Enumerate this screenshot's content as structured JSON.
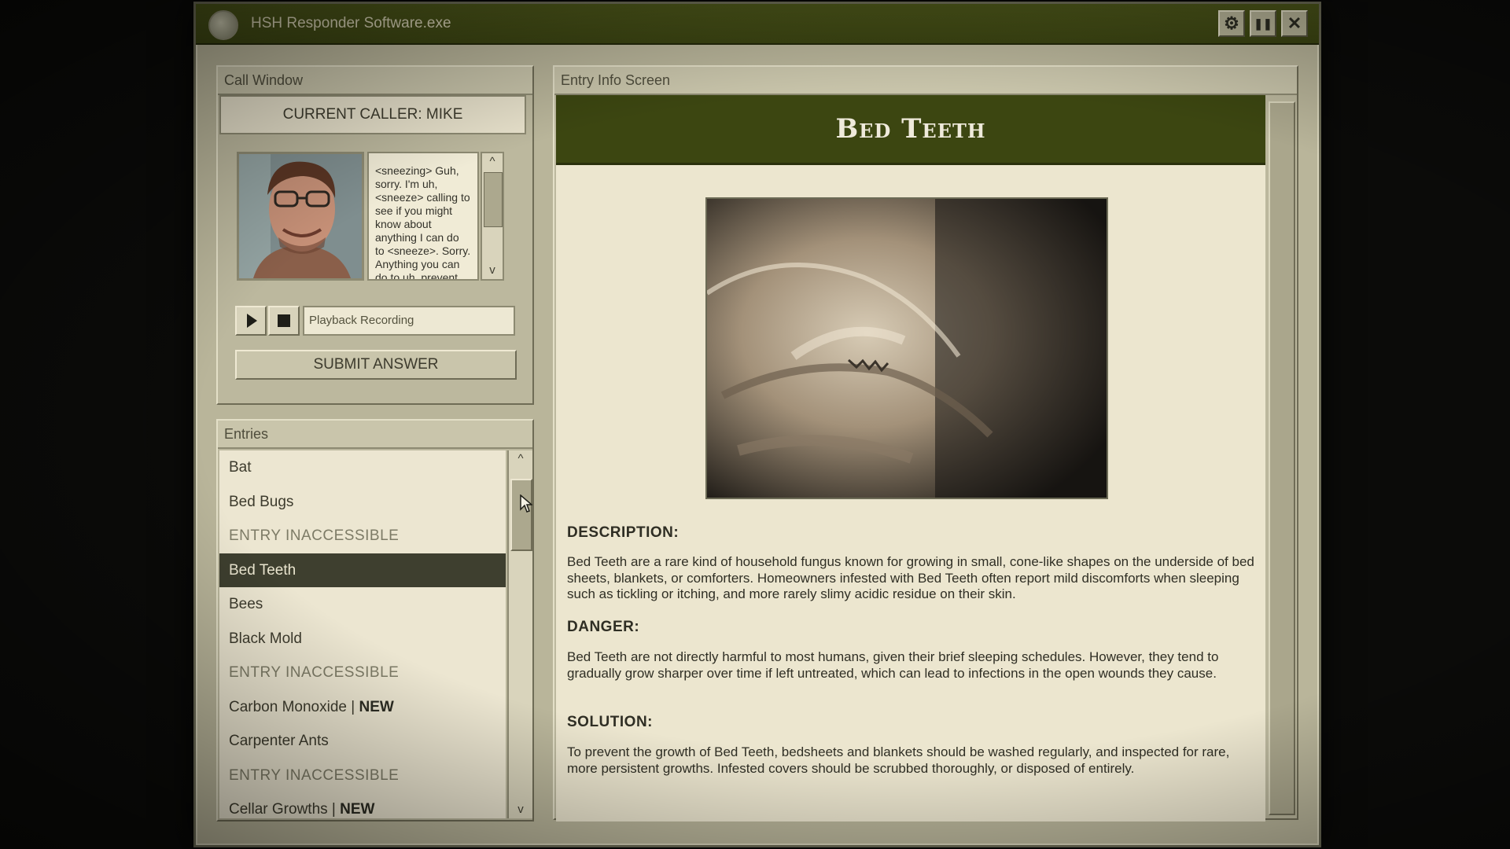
{
  "window": {
    "title": "HSH Responder Software.exe",
    "controls": {
      "settings": "⚙",
      "pause": "❚❚",
      "close": "✕"
    }
  },
  "call_window": {
    "panel_title": "Call Window",
    "current_caller": "CURRENT CALLER: MIKE",
    "transcript": "<sneezing> Guh, sorry. I'm uh, <sneeze> calling to see if you might know about anything I can do to <sneeze>. Sorry. Anything you can do to uh, prevent",
    "scroll_up": "^",
    "scroll_down": "v",
    "playback_placeholder": "Playback Recording",
    "submit_label": "SUBMIT ANSWER"
  },
  "entries_panel": {
    "panel_title": "Entries",
    "scroll_up": "^",
    "scroll_down": "v",
    "items": [
      {
        "label": "Bat",
        "badge": ""
      },
      {
        "label": "Bed Bugs",
        "badge": ""
      },
      {
        "label": "ENTRY INACCESSIBLE",
        "badge": ""
      },
      {
        "label": "Bed Teeth",
        "badge": ""
      },
      {
        "label": "Bees",
        "badge": ""
      },
      {
        "label": "Black Mold",
        "badge": ""
      },
      {
        "label": "ENTRY INACCESSIBLE",
        "badge": ""
      },
      {
        "label": "Carbon Monoxide | ",
        "badge": "NEW"
      },
      {
        "label": "Carpenter Ants",
        "badge": ""
      },
      {
        "label": "ENTRY INACCESSIBLE",
        "badge": ""
      },
      {
        "label": "Cellar Growths | ",
        "badge": "NEW"
      }
    ]
  },
  "entry_info": {
    "panel_title": "Entry Info Screen",
    "entry_title": "Bed Teeth",
    "description_heading": "DESCRIPTION:",
    "description": "Bed Teeth are a rare kind of household fungus known for growing in small, cone-like shapes on the underside of bed sheets, blankets, or comforters. Homeowners infested with Bed Teeth often report mild discomforts when sleeping such as tickling or itching, and more rarely slimy acidic residue on their skin.",
    "danger_heading": "DANGER:",
    "danger": "Bed Teeth are not directly harmful to most humans, given their brief sleeping schedules. However, they tend to gradually grow sharper over time if left untreated, which can lead to infections in the open wounds they cause.",
    "solution_heading": "SOLUTION:",
    "solution": "To prevent the growth of Bed Teeth, bedsheets and blankets should be washed regularly, and inspected for rare, more persistent growths. Infested covers should be scrubbed thoroughly, or disposed of entirely."
  },
  "colors": {
    "titlebar": "#3b4412",
    "panel": "#bcb89e",
    "entry_header": "#3c4611",
    "selected_row": "#3e3f2f"
  }
}
